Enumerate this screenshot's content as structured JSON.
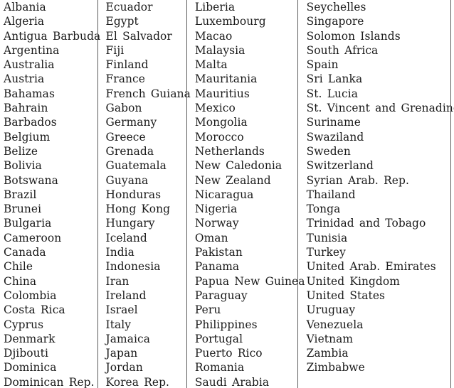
{
  "document": {
    "type": "country-list-table",
    "column_count": 4,
    "rule_color": "#5a5a5a",
    "text_color": "#1a1a1a",
    "background_color": "#ffffff"
  },
  "columns": [
    {
      "id": "column-1",
      "items": [
        "Albania",
        "Algeria",
        "Antigua Barbuda",
        "Argentina",
        "Australia",
        "Austria",
        "Bahamas",
        "Bahrain",
        "Barbados",
        "Belgium",
        "Belize",
        "Bolivia",
        "Botswana",
        "Brazil",
        "Brunei",
        "Bulgaria",
        "Cameroon",
        "Canada",
        "Chile",
        "China",
        "Colombia",
        "Costa Rica",
        "Cyprus",
        "Denmark",
        "Djibouti",
        "Dominica",
        "Dominican Rep."
      ]
    },
    {
      "id": "column-2",
      "items": [
        "Ecuador",
        "Egypt",
        "El Salvador",
        "Fiji",
        "Finland",
        "France",
        "French Guiana",
        "Gabon",
        "Germany",
        "Greece",
        "Grenada",
        "Guatemala",
        "Guyana",
        "Honduras",
        "Hong Kong",
        "Hungary",
        "Iceland",
        "India",
        "Indonesia",
        "Iran",
        "Ireland",
        "Israel",
        "Italy",
        "Jamaica",
        "Japan",
        "Jordan",
        "Korea Rep."
      ]
    },
    {
      "id": "column-3",
      "items": [
        "Liberia",
        "Luxembourg",
        "Macao",
        "Malaysia",
        "Malta",
        "Mauritania",
        "Mauritius",
        "Mexico",
        "Mongolia",
        "Morocco",
        "Netherlands",
        "New Caledonia",
        "New Zealand",
        "Nicaragua",
        "Nigeria",
        "Norway",
        "Oman",
        "Pakistan",
        "Panama",
        "Papua New Guinea",
        "Paraguay",
        "Peru",
        "Philippines",
        "Portugal",
        "Puerto Rico",
        "Romania",
        "Saudi Arabia"
      ]
    },
    {
      "id": "column-4",
      "items": [
        "Seychelles",
        "Singapore",
        "Solomon Islands",
        "South Africa",
        "Spain",
        "Sri Lanka",
        "St. Lucia",
        "St. Vincent and Grenadines",
        "Suriname",
        "Swaziland",
        "Sweden",
        "Switzerland",
        "Syrian Arab. Rep.",
        "Thailand",
        "Tonga",
        "Trinidad and Tobago",
        "Tunisia",
        "Turkey",
        "United Arab. Emirates",
        "United Kingdom",
        "United States",
        "Uruguay",
        "Venezuela",
        "Vietnam",
        "Zambia",
        "Zimbabwe"
      ]
    }
  ]
}
